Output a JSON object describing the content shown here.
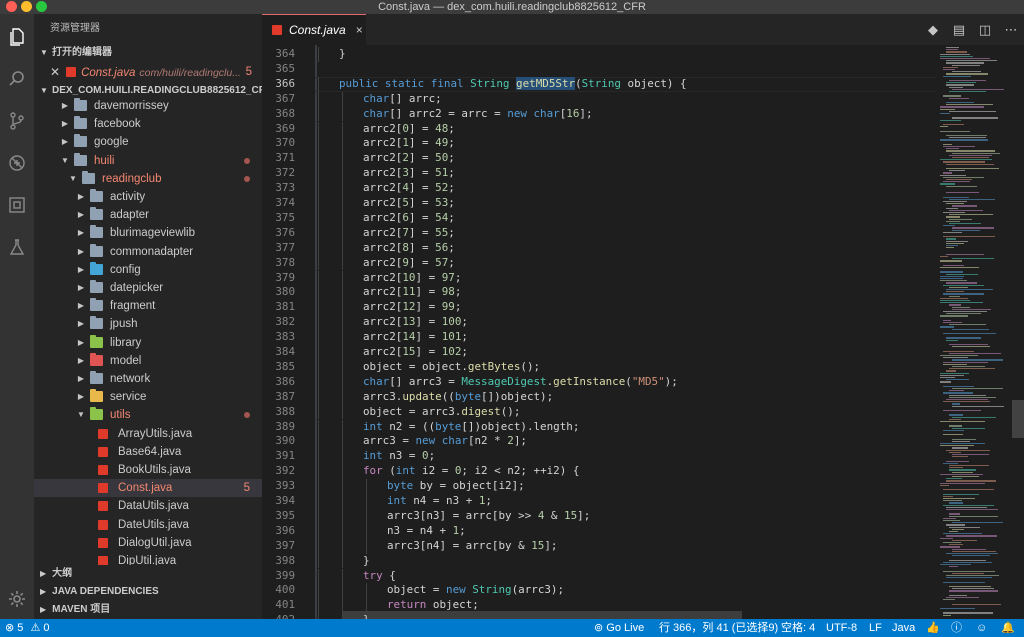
{
  "window": {
    "title": "Const.java — dex_com.huili.readingclub8825612_CFR"
  },
  "activity_bar": {
    "items": [
      "explorer-icon",
      "search-icon",
      "source-control-icon",
      "debug-icon",
      "extensions-icon",
      "flask-icon"
    ],
    "bottom": "gear-icon"
  },
  "sidebar": {
    "title": "资源管理器",
    "open_editors": {
      "label": "打开的编辑器",
      "items": [
        {
          "name": "Const.java",
          "path": "com/huili/readingclu...",
          "count": "5"
        }
      ]
    },
    "project": {
      "label": "DEX_COM.HUILI.READINGCLUB8825612_CFR",
      "tree": [
        {
          "label": "davemorrissey",
          "kind": "folder",
          "depth": 1,
          "state": "closed"
        },
        {
          "label": "facebook",
          "kind": "folder",
          "depth": 1,
          "state": "closed"
        },
        {
          "label": "google",
          "kind": "folder",
          "depth": 1,
          "state": "closed"
        },
        {
          "label": "huili",
          "kind": "folder",
          "depth": 1,
          "state": "open",
          "error": true
        },
        {
          "label": "readingclub",
          "kind": "folder",
          "depth": 2,
          "state": "open",
          "error": true
        },
        {
          "label": "activity",
          "kind": "folder",
          "depth": 3,
          "state": "closed"
        },
        {
          "label": "adapter",
          "kind": "folder",
          "depth": 3,
          "state": "closed"
        },
        {
          "label": "blurimageviewlib",
          "kind": "folder",
          "depth": 3,
          "state": "closed"
        },
        {
          "label": "commonadapter",
          "kind": "folder",
          "depth": 3,
          "state": "closed"
        },
        {
          "label": "config",
          "kind": "folder-config",
          "depth": 3,
          "state": "closed"
        },
        {
          "label": "datepicker",
          "kind": "folder",
          "depth": 3,
          "state": "closed"
        },
        {
          "label": "fragment",
          "kind": "folder",
          "depth": 3,
          "state": "closed"
        },
        {
          "label": "jpush",
          "kind": "folder",
          "depth": 3,
          "state": "closed"
        },
        {
          "label": "library",
          "kind": "folder-lib",
          "depth": 3,
          "state": "closed"
        },
        {
          "label": "model",
          "kind": "folder-model",
          "depth": 3,
          "state": "closed"
        },
        {
          "label": "network",
          "kind": "folder",
          "depth": 3,
          "state": "closed"
        },
        {
          "label": "service",
          "kind": "folder-service",
          "depth": 3,
          "state": "closed"
        },
        {
          "label": "utils",
          "kind": "folder-utils",
          "depth": 3,
          "state": "open",
          "error": true
        },
        {
          "label": "ArrayUtils.java",
          "kind": "java",
          "depth": 4
        },
        {
          "label": "Base64.java",
          "kind": "java",
          "depth": 4
        },
        {
          "label": "BookUtils.java",
          "kind": "java",
          "depth": 4
        },
        {
          "label": "Const.java",
          "kind": "java",
          "depth": 4,
          "selected": true,
          "count": "5"
        },
        {
          "label": "DataUtils.java",
          "kind": "java",
          "depth": 4
        },
        {
          "label": "DateUtils.java",
          "kind": "java",
          "depth": 4
        },
        {
          "label": "DialogUtil.java",
          "kind": "java",
          "depth": 4
        },
        {
          "label": "DipUtil.java",
          "kind": "java",
          "depth": 4
        }
      ]
    },
    "bottom_sections": [
      "大纲",
      "JAVA DEPENDENCIES",
      "MAVEN 项目"
    ]
  },
  "tabs": [
    {
      "label": "Const.java",
      "active": true,
      "close": "×"
    }
  ],
  "editor_actions": [
    "open-changes-icon",
    "preview-icon",
    "split-editor-icon",
    "more-actions-icon"
  ],
  "editor": {
    "current_line": 366,
    "lines": [
      {
        "n": 364,
        "indent": 1,
        "parts": [
          [
            "p",
            "}"
          ]
        ]
      },
      {
        "n": 365,
        "indent": 0,
        "parts": []
      },
      {
        "n": 366,
        "indent": 1,
        "parts": [
          [
            "k",
            "public static final "
          ],
          [
            "t",
            "String "
          ],
          [
            "fh",
            "getMD5Str"
          ],
          [
            "p",
            "("
          ],
          [
            "t",
            "String "
          ],
          [
            "p",
            "object) {"
          ]
        ]
      },
      {
        "n": 367,
        "indent": 2,
        "parts": [
          [
            "k",
            "char"
          ],
          [
            "p",
            "[] arrc;"
          ]
        ]
      },
      {
        "n": 368,
        "indent": 2,
        "parts": [
          [
            "k",
            "char"
          ],
          [
            "p",
            "[] arrc2 = arrc = "
          ],
          [
            "k",
            "new "
          ],
          [
            "k",
            "char"
          ],
          [
            "p",
            "["
          ],
          [
            "n",
            "16"
          ],
          [
            "p",
            "];"
          ]
        ]
      },
      {
        "n": 369,
        "indent": 2,
        "parts": [
          [
            "p",
            "arrc2["
          ],
          [
            "n",
            "0"
          ],
          [
            "p",
            "] = "
          ],
          [
            "n",
            "48"
          ],
          [
            "p",
            ";"
          ]
        ]
      },
      {
        "n": 370,
        "indent": 2,
        "parts": [
          [
            "p",
            "arrc2["
          ],
          [
            "n",
            "1"
          ],
          [
            "p",
            "] = "
          ],
          [
            "n",
            "49"
          ],
          [
            "p",
            ";"
          ]
        ]
      },
      {
        "n": 371,
        "indent": 2,
        "parts": [
          [
            "p",
            "arrc2["
          ],
          [
            "n",
            "2"
          ],
          [
            "p",
            "] = "
          ],
          [
            "n",
            "50"
          ],
          [
            "p",
            ";"
          ]
        ]
      },
      {
        "n": 372,
        "indent": 2,
        "parts": [
          [
            "p",
            "arrc2["
          ],
          [
            "n",
            "3"
          ],
          [
            "p",
            "] = "
          ],
          [
            "n",
            "51"
          ],
          [
            "p",
            ";"
          ]
        ]
      },
      {
        "n": 373,
        "indent": 2,
        "parts": [
          [
            "p",
            "arrc2["
          ],
          [
            "n",
            "4"
          ],
          [
            "p",
            "] = "
          ],
          [
            "n",
            "52"
          ],
          [
            "p",
            ";"
          ]
        ]
      },
      {
        "n": 374,
        "indent": 2,
        "parts": [
          [
            "p",
            "arrc2["
          ],
          [
            "n",
            "5"
          ],
          [
            "p",
            "] = "
          ],
          [
            "n",
            "53"
          ],
          [
            "p",
            ";"
          ]
        ]
      },
      {
        "n": 375,
        "indent": 2,
        "parts": [
          [
            "p",
            "arrc2["
          ],
          [
            "n",
            "6"
          ],
          [
            "p",
            "] = "
          ],
          [
            "n",
            "54"
          ],
          [
            "p",
            ";"
          ]
        ]
      },
      {
        "n": 376,
        "indent": 2,
        "parts": [
          [
            "p",
            "arrc2["
          ],
          [
            "n",
            "7"
          ],
          [
            "p",
            "] = "
          ],
          [
            "n",
            "55"
          ],
          [
            "p",
            ";"
          ]
        ]
      },
      {
        "n": 377,
        "indent": 2,
        "parts": [
          [
            "p",
            "arrc2["
          ],
          [
            "n",
            "8"
          ],
          [
            "p",
            "] = "
          ],
          [
            "n",
            "56"
          ],
          [
            "p",
            ";"
          ]
        ]
      },
      {
        "n": 378,
        "indent": 2,
        "parts": [
          [
            "p",
            "arrc2["
          ],
          [
            "n",
            "9"
          ],
          [
            "p",
            "] = "
          ],
          [
            "n",
            "57"
          ],
          [
            "p",
            ";"
          ]
        ]
      },
      {
        "n": 379,
        "indent": 2,
        "parts": [
          [
            "p",
            "arrc2["
          ],
          [
            "n",
            "10"
          ],
          [
            "p",
            "] = "
          ],
          [
            "n",
            "97"
          ],
          [
            "p",
            ";"
          ]
        ]
      },
      {
        "n": 380,
        "indent": 2,
        "parts": [
          [
            "p",
            "arrc2["
          ],
          [
            "n",
            "11"
          ],
          [
            "p",
            "] = "
          ],
          [
            "n",
            "98"
          ],
          [
            "p",
            ";"
          ]
        ]
      },
      {
        "n": 381,
        "indent": 2,
        "parts": [
          [
            "p",
            "arrc2["
          ],
          [
            "n",
            "12"
          ],
          [
            "p",
            "] = "
          ],
          [
            "n",
            "99"
          ],
          [
            "p",
            ";"
          ]
        ]
      },
      {
        "n": 382,
        "indent": 2,
        "parts": [
          [
            "p",
            "arrc2["
          ],
          [
            "n",
            "13"
          ],
          [
            "p",
            "] = "
          ],
          [
            "n",
            "100"
          ],
          [
            "p",
            ";"
          ]
        ]
      },
      {
        "n": 383,
        "indent": 2,
        "parts": [
          [
            "p",
            "arrc2["
          ],
          [
            "n",
            "14"
          ],
          [
            "p",
            "] = "
          ],
          [
            "n",
            "101"
          ],
          [
            "p",
            ";"
          ]
        ]
      },
      {
        "n": 384,
        "indent": 2,
        "parts": [
          [
            "p",
            "arrc2["
          ],
          [
            "n",
            "15"
          ],
          [
            "p",
            "] = "
          ],
          [
            "n",
            "102"
          ],
          [
            "p",
            ";"
          ]
        ]
      },
      {
        "n": 385,
        "indent": 2,
        "parts": [
          [
            "p",
            "object = object."
          ],
          [
            "f",
            "getBytes"
          ],
          [
            "p",
            "();"
          ]
        ]
      },
      {
        "n": 386,
        "indent": 2,
        "parts": [
          [
            "k",
            "char"
          ],
          [
            "p",
            "[] arrc3 = "
          ],
          [
            "t",
            "MessageDigest"
          ],
          [
            "p",
            "."
          ],
          [
            "f",
            "getInstance"
          ],
          [
            "p",
            "("
          ],
          [
            "s",
            "\"MD5\""
          ],
          [
            "p",
            ");"
          ]
        ]
      },
      {
        "n": 387,
        "indent": 2,
        "parts": [
          [
            "p",
            "arrc3."
          ],
          [
            "f",
            "update"
          ],
          [
            "p",
            "(("
          ],
          [
            "k",
            "byte"
          ],
          [
            "p",
            "[])object);"
          ]
        ]
      },
      {
        "n": 388,
        "indent": 2,
        "parts": [
          [
            "p",
            "object = arrc3."
          ],
          [
            "f",
            "digest"
          ],
          [
            "p",
            "();"
          ]
        ]
      },
      {
        "n": 389,
        "indent": 2,
        "parts": [
          [
            "k",
            "int "
          ],
          [
            "p",
            "n2 = (("
          ],
          [
            "k",
            "byte"
          ],
          [
            "p",
            "[])object).length;"
          ]
        ]
      },
      {
        "n": 390,
        "indent": 2,
        "parts": [
          [
            "p",
            "arrc3 = "
          ],
          [
            "k",
            "new "
          ],
          [
            "k",
            "char"
          ],
          [
            "p",
            "[n2 * "
          ],
          [
            "n",
            "2"
          ],
          [
            "p",
            "];"
          ]
        ]
      },
      {
        "n": 391,
        "indent": 2,
        "parts": [
          [
            "k",
            "int "
          ],
          [
            "p",
            "n3 = "
          ],
          [
            "n",
            "0"
          ],
          [
            "p",
            ";"
          ]
        ]
      },
      {
        "n": 392,
        "indent": 2,
        "parts": [
          [
            "c",
            "for "
          ],
          [
            "p",
            "("
          ],
          [
            "k",
            "int "
          ],
          [
            "p",
            "i2 = "
          ],
          [
            "n",
            "0"
          ],
          [
            "p",
            "; i2 < n2; ++i2) {"
          ]
        ]
      },
      {
        "n": 393,
        "indent": 3,
        "parts": [
          [
            "k",
            "byte "
          ],
          [
            "p",
            "by = object[i2];"
          ]
        ]
      },
      {
        "n": 394,
        "indent": 3,
        "parts": [
          [
            "k",
            "int "
          ],
          [
            "p",
            "n4 = n3 + "
          ],
          [
            "n",
            "1"
          ],
          [
            "p",
            ";"
          ]
        ]
      },
      {
        "n": 395,
        "indent": 3,
        "parts": [
          [
            "p",
            "arrc3[n3] = arrc[by >> "
          ],
          [
            "n",
            "4"
          ],
          [
            "p",
            " & "
          ],
          [
            "n",
            "15"
          ],
          [
            "p",
            "];"
          ]
        ]
      },
      {
        "n": 396,
        "indent": 3,
        "parts": [
          [
            "p",
            "n3 = n4 + "
          ],
          [
            "n",
            "1"
          ],
          [
            "p",
            ";"
          ]
        ]
      },
      {
        "n": 397,
        "indent": 3,
        "parts": [
          [
            "p",
            "arrc3[n4] = arrc[by & "
          ],
          [
            "n",
            "15"
          ],
          [
            "p",
            "];"
          ]
        ]
      },
      {
        "n": 398,
        "indent": 2,
        "parts": [
          [
            "p",
            "}"
          ]
        ]
      },
      {
        "n": 399,
        "indent": 2,
        "parts": [
          [
            "c",
            "try "
          ],
          [
            "p",
            "{"
          ]
        ]
      },
      {
        "n": 400,
        "indent": 3,
        "parts": [
          [
            "p",
            "object = "
          ],
          [
            "k",
            "new "
          ],
          [
            "t",
            "String"
          ],
          [
            "p",
            "(arrc3);"
          ]
        ]
      },
      {
        "n": 401,
        "indent": 3,
        "parts": [
          [
            "c",
            "return "
          ],
          [
            "p",
            "object;"
          ]
        ]
      },
      {
        "n": 402,
        "indent": 2,
        "parts": [
          [
            "p",
            "}"
          ]
        ]
      }
    ]
  },
  "statusbar": {
    "errors": "5",
    "warnings": "0",
    "golive": "Go Live",
    "position": "行 366，列 41 (已选择9)",
    "spaces": "空格: 4",
    "encoding": "UTF-8",
    "eol": "LF",
    "language": "Java"
  },
  "colors": {
    "statusbar": "#007acc",
    "error": "#f48771",
    "activity_bar": "#333333",
    "sidebar": "#252526",
    "editor": "#1e1e1e"
  }
}
